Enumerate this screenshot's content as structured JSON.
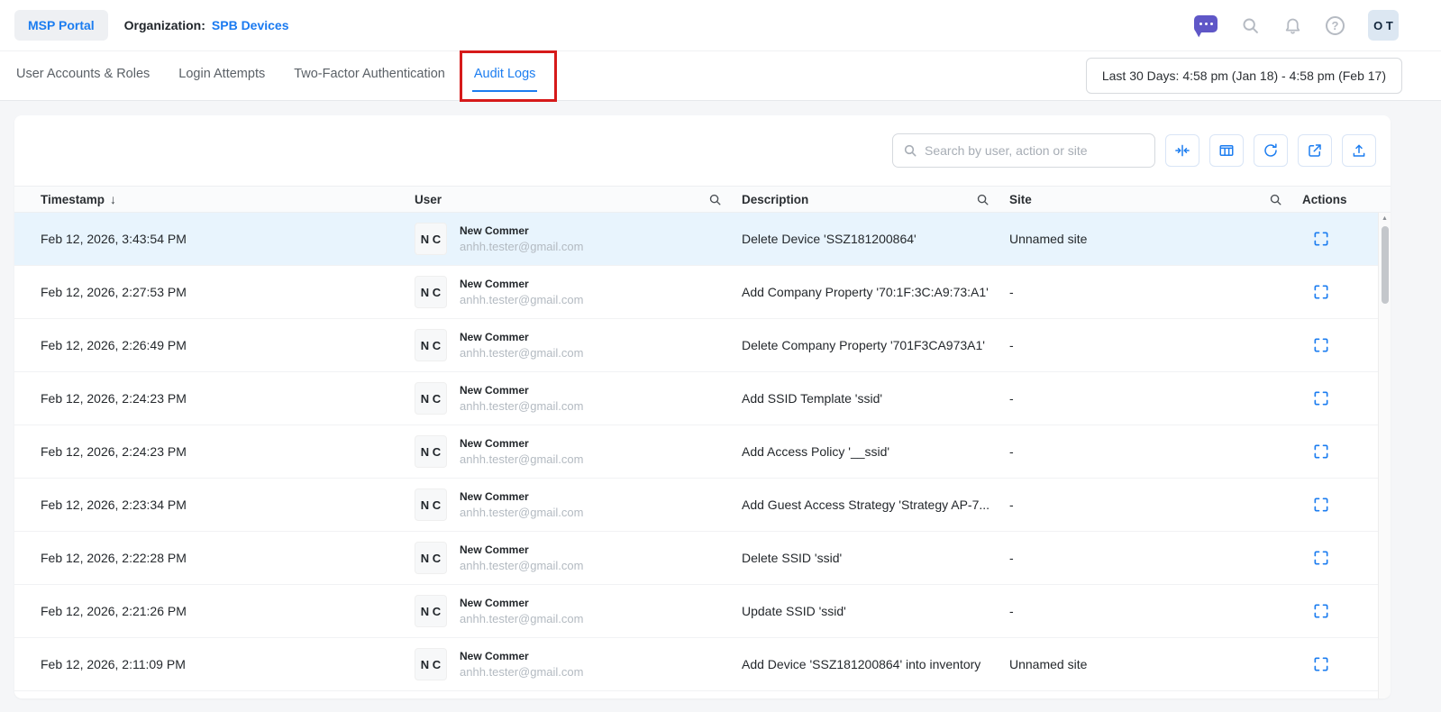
{
  "header": {
    "portal_button_label": "MSP Portal",
    "organization_label": "Organization:",
    "organization_name": "SPB Devices",
    "avatar_initials": "O T"
  },
  "tabs": [
    {
      "label": "User Accounts & Roles",
      "active": false
    },
    {
      "label": "Login Attempts",
      "active": false
    },
    {
      "label": "Two-Factor Authentication",
      "active": false
    },
    {
      "label": "Audit Logs",
      "active": true,
      "annotated": true
    }
  ],
  "filters": {
    "date_range_label": "Last 30 Days: 4:58 pm (Jan 18) - 4:58 pm (Feb 17)"
  },
  "toolbar": {
    "search_placeholder": "Search by user, action or site"
  },
  "table": {
    "columns": {
      "timestamp": "Timestamp",
      "user": "User",
      "description": "Description",
      "site": "Site",
      "actions": "Actions"
    },
    "rows": [
      {
        "timestamp": "Feb 12, 2026, 3:43:54 PM",
        "user_initials": "N C",
        "user_name": "New Commer",
        "user_email": "anhh.tester@gmail.com",
        "description": "Delete Device 'SSZ181200864'",
        "site": "Unnamed site",
        "highlighted": true
      },
      {
        "timestamp": "Feb 12, 2026, 2:27:53 PM",
        "user_initials": "N C",
        "user_name": "New Commer",
        "user_email": "anhh.tester@gmail.com",
        "description": "Add Company Property '70:1F:3C:A9:73:A1'",
        "site": "-"
      },
      {
        "timestamp": "Feb 12, 2026, 2:26:49 PM",
        "user_initials": "N C",
        "user_name": "New Commer",
        "user_email": "anhh.tester@gmail.com",
        "description": "Delete Company Property '701F3CA973A1'",
        "site": "-"
      },
      {
        "timestamp": "Feb 12, 2026, 2:24:23 PM",
        "user_initials": "N C",
        "user_name": "New Commer",
        "user_email": "anhh.tester@gmail.com",
        "description": "Add SSID Template 'ssid'",
        "site": "-"
      },
      {
        "timestamp": "Feb 12, 2026, 2:24:23 PM",
        "user_initials": "N C",
        "user_name": "New Commer",
        "user_email": "anhh.tester@gmail.com",
        "description": "Add Access Policy '__ssid'",
        "site": "-"
      },
      {
        "timestamp": "Feb 12, 2026, 2:23:34 PM",
        "user_initials": "N C",
        "user_name": "New Commer",
        "user_email": "anhh.tester@gmail.com",
        "description": "Add Guest Access Strategy 'Strategy AP-7...",
        "site": "-"
      },
      {
        "timestamp": "Feb 12, 2026, 2:22:28 PM",
        "user_initials": "N C",
        "user_name": "New Commer",
        "user_email": "anhh.tester@gmail.com",
        "description": "Delete SSID 'ssid'",
        "site": "-"
      },
      {
        "timestamp": "Feb 12, 2026, 2:21:26 PM",
        "user_initials": "N C",
        "user_name": "New Commer",
        "user_email": "anhh.tester@gmail.com",
        "description": "Update SSID 'ssid'",
        "site": "-"
      },
      {
        "timestamp": "Feb 12, 2026, 2:11:09 PM",
        "user_initials": "N C",
        "user_name": "New Commer",
        "user_email": "anhh.tester@gmail.com",
        "description": "Add Device 'SSZ181200864' into inventory",
        "site": "Unnamed site"
      }
    ]
  },
  "icons": {
    "sort_desc": "↓",
    "help_glyph": "?",
    "scroll_up_glyph": "▲"
  },
  "colors": {
    "accent_blue": "#1c7df0",
    "link_blue": "#1a7af0",
    "row_highlight": "#e8f4fd",
    "annotation_red": "#d61a1a",
    "assistant_purple": "#5f57c7"
  }
}
